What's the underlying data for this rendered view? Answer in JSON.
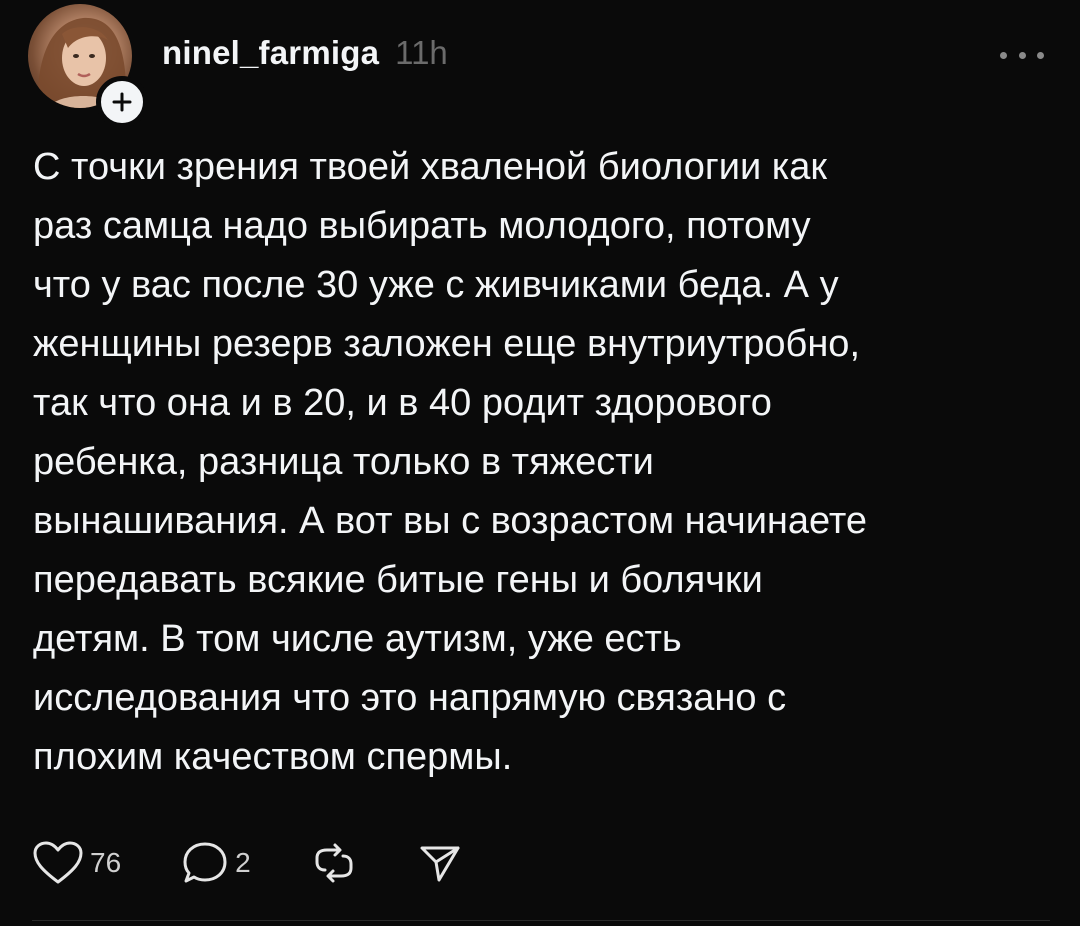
{
  "post": {
    "username": "ninel_farmiga",
    "time": "11h",
    "text": "С точки зрения твоей хваленой биологии как\nраз самца надо выбирать молодого, потому\nчто у вас после 30 уже с живчиками беда. А у\nженщины резерв заложен еще внутриутробно,\nтак что она и в 20, и в 40 родит здорового\nребенка, разница только в тяжести\nвынашивания. А вот вы с возрастом начинаете\nпередавать всякие битые гены и болячки\nдетям. В том числе аутизм, уже есть\nисследования что это напрямую связано с\nплохим качеством спермы.",
    "likes": "76",
    "replies": "2"
  },
  "icons": {
    "follow": "plus-icon",
    "more": "more-horizontal-icon",
    "like": "heart-icon",
    "reply": "comment-icon",
    "repost": "repost-icon",
    "share": "send-icon"
  },
  "colors": {
    "background": "#0a0a0a",
    "text": "#f3f5f7",
    "muted": "#6b6b6b"
  }
}
